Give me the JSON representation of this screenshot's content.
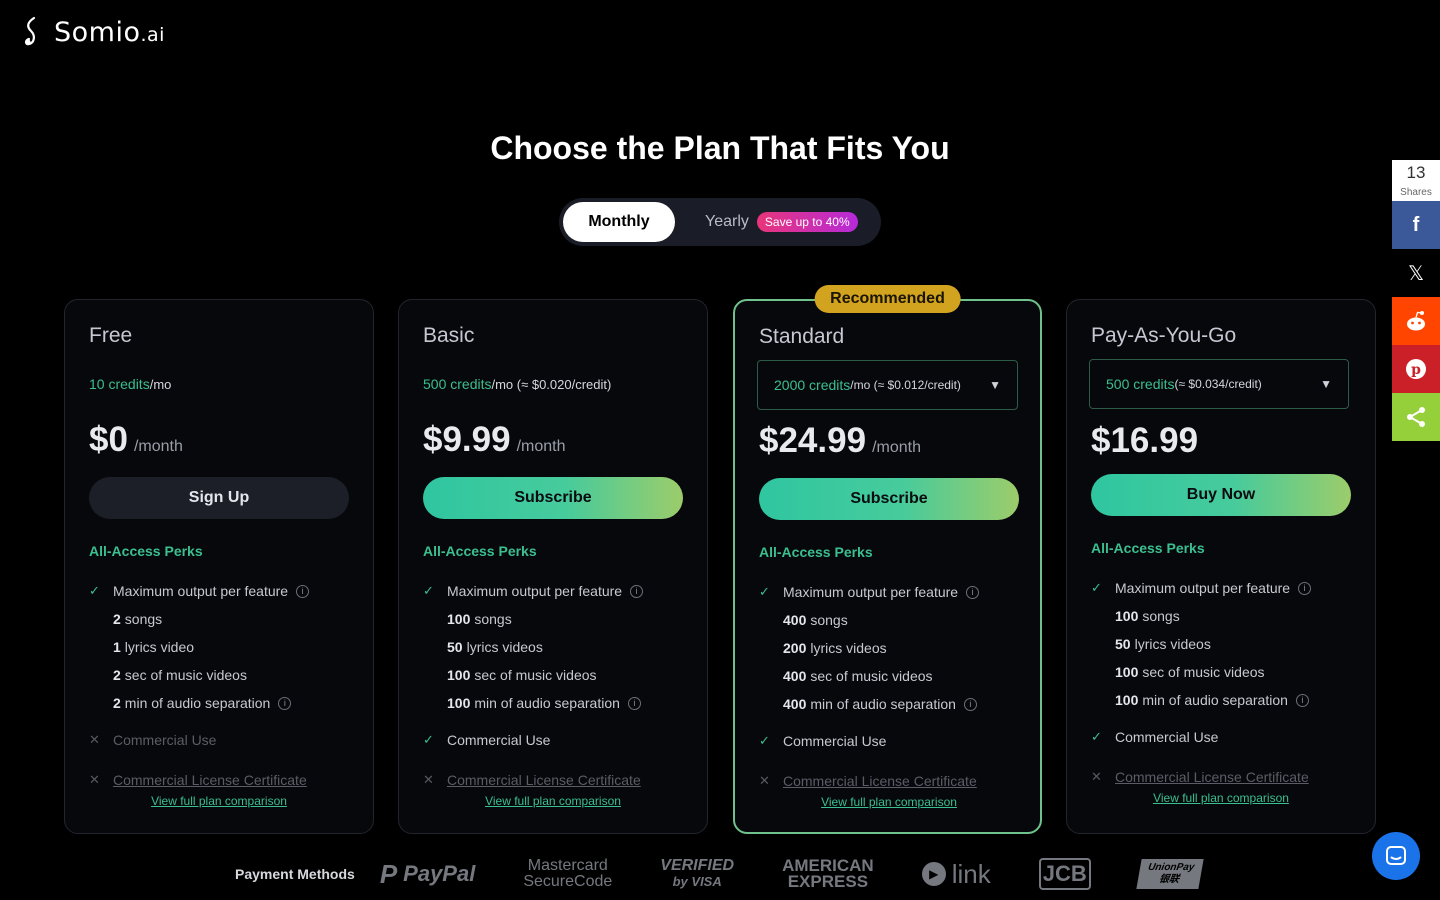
{
  "brand": {
    "name": "Somio",
    "suffix": ".ai"
  },
  "page": {
    "title": "Choose the Plan That Fits You"
  },
  "billing": {
    "monthly": "Monthly",
    "yearly": "Yearly",
    "save_badge": "Save up to 40%"
  },
  "plans": [
    {
      "name": "Free",
      "credits_value": "10 credits",
      "credits_suffix": "/mo",
      "price": "$0",
      "period": "/month",
      "cta": "Sign Up",
      "perks_title": "All-Access Perks",
      "features": {
        "max_output": "Maximum output per feature",
        "songs_n": "2",
        "songs": "songs",
        "lyrics_n": "1",
        "lyrics": "lyrics video",
        "mv_n": "2",
        "mv": "sec of music videos",
        "sep_n": "2",
        "sep": "min of audio separation",
        "commercial": "Commercial Use",
        "license": "Commercial License Certificate"
      },
      "compare": "View full plan comparison"
    },
    {
      "name": "Basic",
      "credits_value": "500 credits",
      "credits_suffix": "/mo (≈ $0.020/credit)",
      "price": "$9.99",
      "period": "/month",
      "cta": "Subscribe",
      "perks_title": "All-Access Perks",
      "features": {
        "max_output": "Maximum output per feature",
        "songs_n": "100",
        "songs": "songs",
        "lyrics_n": "50",
        "lyrics": "lyrics videos",
        "mv_n": "100",
        "mv": "sec of music videos",
        "sep_n": "100",
        "sep": "min of audio separation",
        "commercial": "Commercial Use",
        "license": "Commercial License Certificate"
      },
      "compare": "View full plan comparison"
    },
    {
      "name": "Standard",
      "badge": "Recommended",
      "credits_value": "2000 credits",
      "credits_suffix": "/mo (≈ $0.012/credit)",
      "price": "$24.99",
      "period": "/month",
      "cta": "Subscribe",
      "perks_title": "All-Access Perks",
      "features": {
        "max_output": "Maximum output per feature",
        "songs_n": "400",
        "songs": "songs",
        "lyrics_n": "200",
        "lyrics": "lyrics videos",
        "mv_n": "400",
        "mv": "sec of music videos",
        "sep_n": "400",
        "sep": "min of audio separation",
        "commercial": "Commercial Use",
        "license": "Commercial License Certificate"
      },
      "compare": "View full plan comparison"
    },
    {
      "name": "Pay-As-You-Go",
      "credits_value": "500 credits",
      "credits_suffix": "(≈ $0.034/credit)",
      "price": "$16.99",
      "cta": "Buy Now",
      "perks_title": "All-Access Perks",
      "features": {
        "max_output": "Maximum output per feature",
        "songs_n": "100",
        "songs": "songs",
        "lyrics_n": "50",
        "lyrics": "lyrics videos",
        "mv_n": "100",
        "mv": "sec of music videos",
        "sep_n": "100",
        "sep": "min of audio separation",
        "commercial": "Commercial Use",
        "license": "Commercial License Certificate"
      },
      "compare": "View full plan comparison"
    }
  ],
  "payment": {
    "label": "Payment Methods",
    "methods": [
      "PayPal",
      "Mastercard",
      "SecureCode",
      "VERIFIED",
      "by VISA",
      "AMERICAN",
      "EXPRESS",
      "link",
      "JCB",
      "UnionPay",
      "银联"
    ]
  },
  "share": {
    "count": "13",
    "label": "Shares"
  },
  "colors": {
    "accent": "#3bbf8f",
    "badge": "#d2a31f",
    "facebook": "#3b5998",
    "reddit": "#ff4500",
    "pinterest": "#cb2027",
    "sharethis": "#95d03a",
    "chat": "#1a73e8"
  }
}
